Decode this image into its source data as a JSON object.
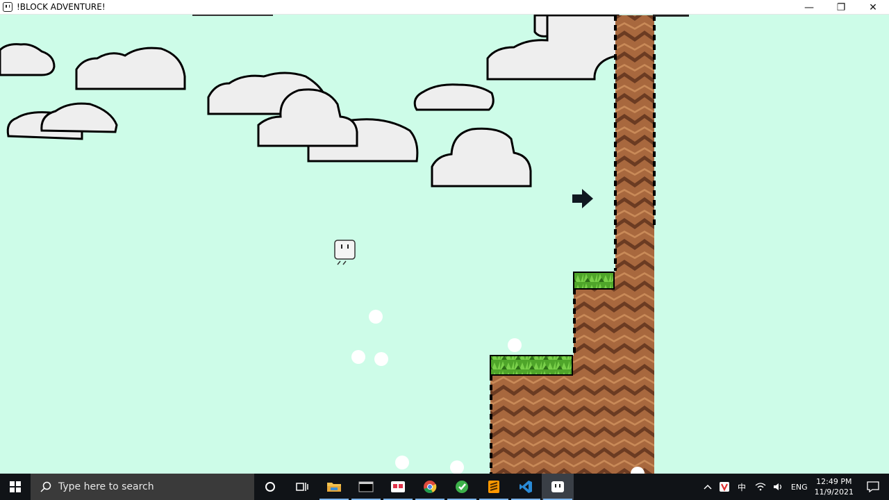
{
  "window": {
    "title": "!BLOCK ADVENTURE!",
    "controls": [
      "—",
      "❐",
      "✕"
    ]
  },
  "game": {
    "sky_color": "#cdfce8",
    "dirt_color": "#a8683e",
    "dirt_dark": "#5e3420",
    "grass_color": "#58b830",
    "arrow_direction": "right"
  },
  "taskbar": {
    "search_placeholder": "Type here to search",
    "apps": [
      "task-view",
      "file-explorer",
      "terminal",
      "photos",
      "chrome",
      "git-app",
      "sublime-text",
      "vs-code",
      "block-adventure"
    ],
    "tray": {
      "lang": "ENG",
      "time": "12:49 PM",
      "date": "11/9/2021"
    }
  }
}
